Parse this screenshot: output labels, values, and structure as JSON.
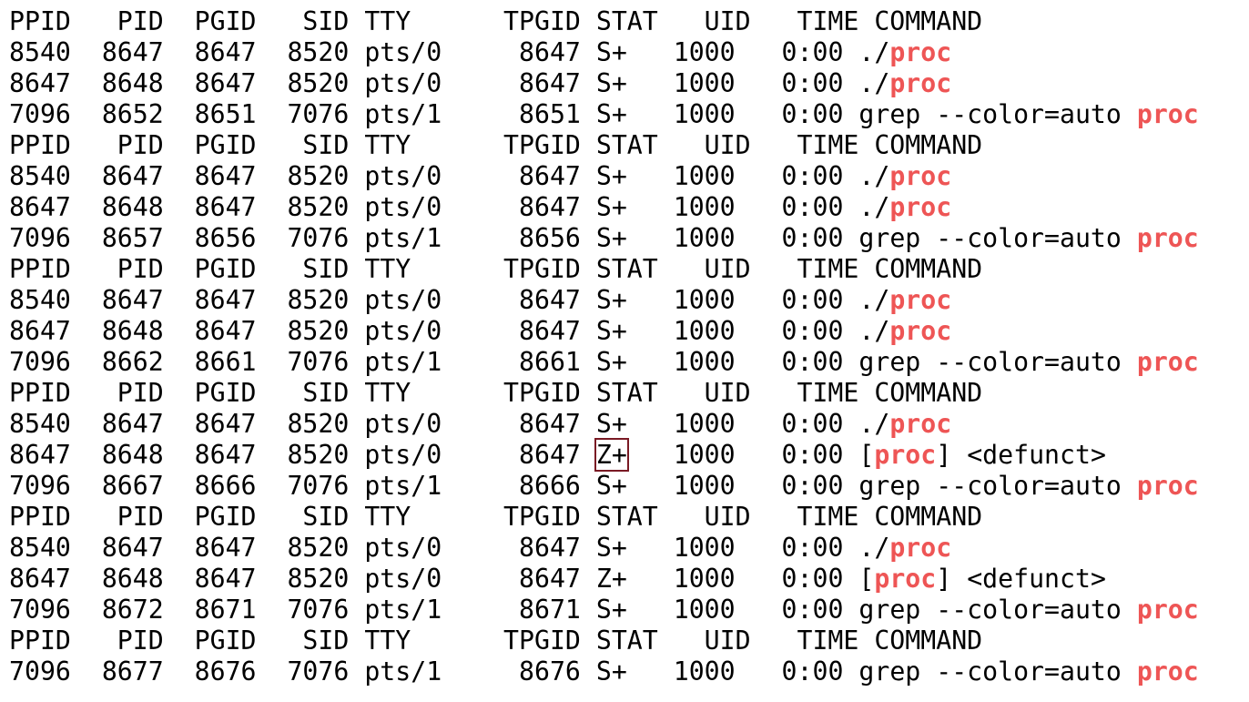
{
  "colors": {
    "background": "#ffffff",
    "text": "#000000",
    "match": "#ee5555",
    "highlight_box": "#7a1a24"
  },
  "grep_term": "proc",
  "lines": [
    {
      "type": "header",
      "text": "PPID   PID  PGID   SID TTY      TPGID STAT   UID   TIME COMMAND"
    },
    {
      "type": "row",
      "pre": "8540  8647  8647  8520 pts/0     8647 ",
      "stat": "S+",
      "post": "   1000   0:00 ./",
      "match": "proc",
      "tail": ""
    },
    {
      "type": "row",
      "pre": "8647  8648  8647  8520 pts/0     8647 ",
      "stat": "S+",
      "post": "   1000   0:00 ./",
      "match": "proc",
      "tail": ""
    },
    {
      "type": "row",
      "pre": "7096  8652  8651  7076 pts/1     8651 ",
      "stat": "S+",
      "post": "   1000   0:00 grep --color=auto ",
      "match": "proc",
      "tail": ""
    },
    {
      "type": "header",
      "text": "PPID   PID  PGID   SID TTY      TPGID STAT   UID   TIME COMMAND"
    },
    {
      "type": "row",
      "pre": "8540  8647  8647  8520 pts/0     8647 ",
      "stat": "S+",
      "post": "   1000   0:00 ./",
      "match": "proc",
      "tail": ""
    },
    {
      "type": "row",
      "pre": "8647  8648  8647  8520 pts/0     8647 ",
      "stat": "S+",
      "post": "   1000   0:00 ./",
      "match": "proc",
      "tail": ""
    },
    {
      "type": "row",
      "pre": "7096  8657  8656  7076 pts/1     8656 ",
      "stat": "S+",
      "post": "   1000   0:00 grep --color=auto ",
      "match": "proc",
      "tail": ""
    },
    {
      "type": "header",
      "text": "PPID   PID  PGID   SID TTY      TPGID STAT   UID   TIME COMMAND"
    },
    {
      "type": "row",
      "pre": "8540  8647  8647  8520 pts/0     8647 ",
      "stat": "S+",
      "post": "   1000   0:00 ./",
      "match": "proc",
      "tail": ""
    },
    {
      "type": "row",
      "pre": "8647  8648  8647  8520 pts/0     8647 ",
      "stat": "S+",
      "post": "   1000   0:00 ./",
      "match": "proc",
      "tail": ""
    },
    {
      "type": "row",
      "pre": "7096  8662  8661  7076 pts/1     8661 ",
      "stat": "S+",
      "post": "   1000   0:00 grep --color=auto ",
      "match": "proc",
      "tail": ""
    },
    {
      "type": "header",
      "text": "PPID   PID  PGID   SID TTY      TPGID STAT   UID   TIME COMMAND"
    },
    {
      "type": "row",
      "pre": "8540  8647  8647  8520 pts/0     8647 ",
      "stat": "S+",
      "post": "   1000   0:00 ./",
      "match": "proc",
      "tail": ""
    },
    {
      "type": "row",
      "pre": "8647  8648  8647  8520 pts/0     8647 ",
      "stat": "Z+",
      "boxed": true,
      "post": "   1000   0:00 [",
      "match": "proc",
      "tail": "] <defunct>"
    },
    {
      "type": "row",
      "pre": "7096  8667  8666  7076 pts/1     8666 ",
      "stat": "S+",
      "post": "   1000   0:00 grep --color=auto ",
      "match": "proc",
      "tail": ""
    },
    {
      "type": "header",
      "text": "PPID   PID  PGID   SID TTY      TPGID STAT   UID   TIME COMMAND"
    },
    {
      "type": "row",
      "pre": "8540  8647  8647  8520 pts/0     8647 ",
      "stat": "S+",
      "post": "   1000   0:00 ./",
      "match": "proc",
      "tail": ""
    },
    {
      "type": "row",
      "pre": "8647  8648  8647  8520 pts/0     8647 ",
      "stat": "Z+",
      "post": "   1000   0:00 [",
      "match": "proc",
      "tail": "] <defunct>"
    },
    {
      "type": "row",
      "pre": "7096  8672  8671  7076 pts/1     8671 ",
      "stat": "S+",
      "post": "   1000   0:00 grep --color=auto ",
      "match": "proc",
      "tail": ""
    },
    {
      "type": "header",
      "text": "PPID   PID  PGID   SID TTY      TPGID STAT   UID   TIME COMMAND"
    },
    {
      "type": "row",
      "pre": "7096  8677  8676  7076 pts/1     8676 ",
      "stat": "S+",
      "post": "   1000   0:00 grep --color=auto ",
      "match": "proc",
      "tail": ""
    }
  ]
}
